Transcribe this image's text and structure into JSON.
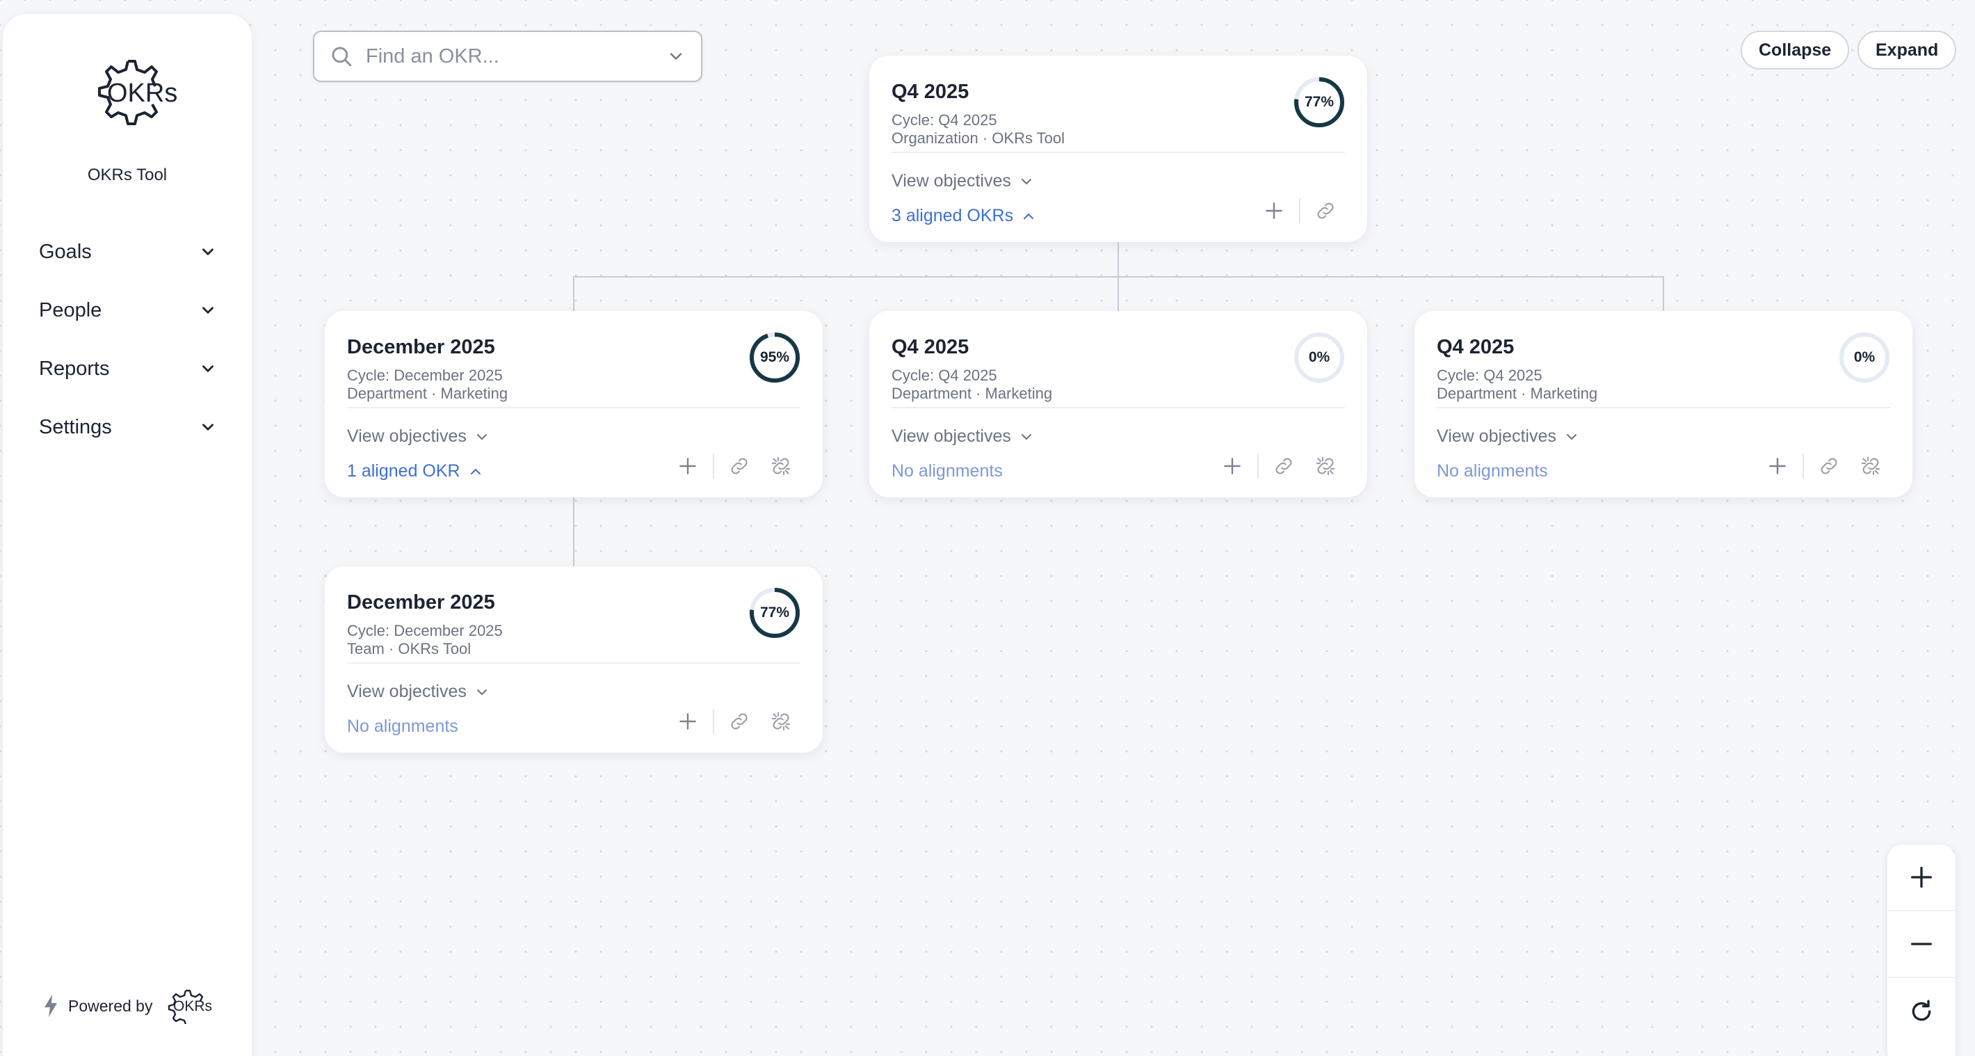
{
  "sidebar": {
    "brand_logo_text": "OKRs",
    "brand_name": "OKRs Tool",
    "nav": [
      {
        "label": "Goals"
      },
      {
        "label": "People"
      },
      {
        "label": "Reports"
      },
      {
        "label": "Settings"
      }
    ],
    "powered_label": "Powered by",
    "powered_logo_text": "OKRs"
  },
  "search": {
    "placeholder": "Find an OKR..."
  },
  "toolbar": {
    "collapse_label": "Collapse",
    "expand_label": "Expand"
  },
  "cards": [
    {
      "title": "Q4 2025",
      "cycle": "Cycle: Q4 2025",
      "owner": "Organization · OKRs Tool",
      "progress": 77,
      "progress_label": "77%",
      "view_label": "View objectives",
      "align_label": "3 aligned OKRs",
      "has_unlink": false
    },
    {
      "title": "December 2025",
      "cycle": "Cycle: December 2025",
      "owner": "Department · Marketing",
      "progress": 95,
      "progress_label": "95%",
      "view_label": "View objectives",
      "align_label": "1 aligned OKR",
      "has_unlink": true
    },
    {
      "title": "Q4 2025",
      "cycle": "Cycle: Q4 2025",
      "owner": "Department · Marketing",
      "progress": 0,
      "progress_label": "0%",
      "view_label": "View objectives",
      "align_label": "No alignments",
      "has_unlink": true
    },
    {
      "title": "Q4 2025",
      "cycle": "Cycle: Q4 2025",
      "owner": "Department · Marketing",
      "progress": 0,
      "progress_label": "0%",
      "view_label": "View objectives",
      "align_label": "No alignments",
      "has_unlink": true
    },
    {
      "title": "December 2025",
      "cycle": "Cycle: December 2025",
      "owner": "Team · OKRs Tool",
      "progress": 77,
      "progress_label": "77%",
      "view_label": "View objectives",
      "align_label": "No alignments",
      "has_unlink": true
    }
  ],
  "colors": {
    "ring_fill": "#163845",
    "ring_track": "#e6ebf2",
    "link_blue": "#3d6fd6"
  },
  "icons": [
    "search-icon",
    "chevron-down-icon",
    "chevron-up-icon",
    "plus-icon",
    "link-icon",
    "unlink-icon",
    "zoom-in-icon",
    "zoom-out-icon",
    "reset-icon",
    "bolt-icon",
    "gear-logo-icon"
  ]
}
